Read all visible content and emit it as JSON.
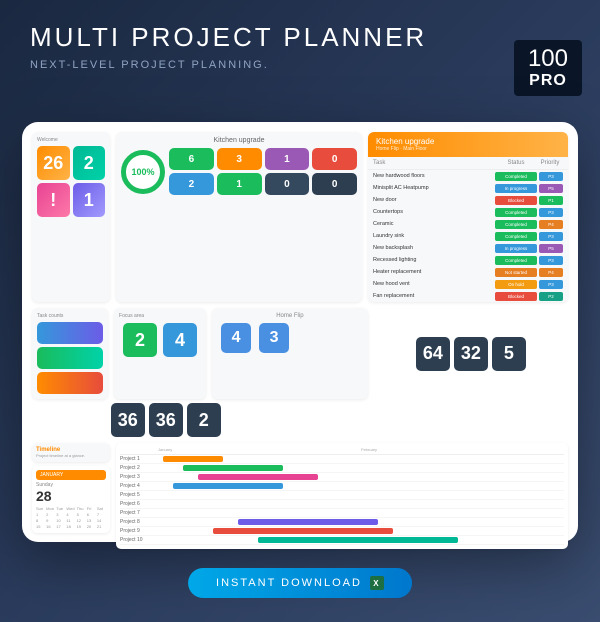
{
  "badge": {
    "num": "100",
    "tag": "PRO"
  },
  "title": "MULTI PROJECT PLANNER",
  "subtitle": "NEXT-LEVEL PROJECT PLANNING.",
  "welcome": {
    "label": "Welcome",
    "tiles": [
      {
        "num": "26",
        "lbl": "",
        "c1": "#ff8c00",
        "c2": "#ffb347"
      },
      {
        "num": "2",
        "lbl": "",
        "c1": "#00b894",
        "c2": "#00d2a8"
      },
      {
        "num": "!",
        "lbl": "",
        "c1": "#e84393",
        "c2": "#fd79a8"
      },
      {
        "num": "1",
        "lbl": "",
        "c1": "#6c5ce7",
        "c2": "#a29bfe"
      }
    ]
  },
  "kitchen": {
    "title": "Kitchen upgrade",
    "pct": "100%",
    "tiles": [
      {
        "num": "6",
        "c": "#1abc5c"
      },
      {
        "num": "3",
        "c": "#ff8c00"
      },
      {
        "num": "1",
        "c": "#9b59b6"
      },
      {
        "num": "0",
        "c": "#e74c3c"
      },
      {
        "num": "2",
        "c": "#3498db"
      },
      {
        "num": "1",
        "c": "#1abc5c"
      },
      {
        "num": "0",
        "c": "#34495e"
      },
      {
        "num": "0",
        "c": "#2c3e50"
      }
    ]
  },
  "taskTable": {
    "header": "Kitchen upgrade",
    "sub": "Home Flip · Main Floor",
    "cols": [
      "Task",
      "Status",
      "Priority"
    ],
    "rows": [
      {
        "task": "New hardwood floors",
        "status": "Completed",
        "sc": "#1abc5c",
        "pri": "P3",
        "pc": "#3498db"
      },
      {
        "task": "Minisplit AC Heatpump",
        "status": "In progress",
        "sc": "#3498db",
        "pri": "P5",
        "pc": "#9b59b6"
      },
      {
        "task": "New door",
        "status": "Blocked",
        "sc": "#e74c3c",
        "pri": "P1",
        "pc": "#1abc5c"
      },
      {
        "task": "Countertops",
        "status": "Completed",
        "sc": "#1abc5c",
        "pri": "P3",
        "pc": "#3498db"
      },
      {
        "task": "Ceramic",
        "status": "Completed",
        "sc": "#1abc5c",
        "pri": "P4",
        "pc": "#e67e22"
      },
      {
        "task": "Laundry sink",
        "status": "Completed",
        "sc": "#1abc5c",
        "pri": "P3",
        "pc": "#3498db"
      },
      {
        "task": "New backsplash",
        "status": "In progress",
        "sc": "#3498db",
        "pri": "P5",
        "pc": "#9b59b6"
      },
      {
        "task": "Recessed lighting",
        "status": "Completed",
        "sc": "#1abc5c",
        "pri": "P3",
        "pc": "#3498db"
      },
      {
        "task": "Heater replacement",
        "status": "Not started",
        "sc": "#e67e22",
        "pri": "P4",
        "pc": "#e67e22"
      },
      {
        "task": "New hood vent",
        "status": "On hold",
        "sc": "#f39c12",
        "pri": "P3",
        "pc": "#3498db"
      },
      {
        "task": "Fan replacement",
        "status": "Blocked",
        "sc": "#e74c3c",
        "pri": "P2",
        "pc": "#16a085"
      }
    ]
  },
  "taskCount": {
    "label": "Task counts",
    "tiles": [
      {
        "num": "",
        "c1": "#3498db",
        "c2": "#6c5ce7"
      },
      {
        "num": "",
        "c1": "#1abc5c",
        "c2": "#00d2a8"
      },
      {
        "num": "",
        "c1": "#ff8c00",
        "c2": "#e74c3c"
      }
    ]
  },
  "focus": {
    "label": "Focus area",
    "tiles": [
      {
        "num": "2",
        "c": "#1abc5c"
      },
      {
        "num": "4",
        "c": "#3498db"
      }
    ]
  },
  "homeflip": {
    "label": "Home Flip",
    "stats": [
      {
        "v": "4"
      },
      {
        "v": "3"
      }
    ]
  },
  "dark1": [
    {
      "n": "36"
    },
    {
      "n": "36"
    },
    {
      "n": "2"
    }
  ],
  "dark2": [
    {
      "n": "64"
    },
    {
      "n": "32"
    },
    {
      "n": "5"
    }
  ],
  "timeline": {
    "label": "Timeline",
    "sub": "Project timeline at a glance."
  },
  "calendar": {
    "month": "JANUARY",
    "day": "Sunday",
    "date": "28",
    "days": [
      "Sun",
      "Mon",
      "Tue",
      "Wed",
      "Thu",
      "Fri",
      "Sat"
    ]
  },
  "gantt": {
    "months": [
      "January",
      "February"
    ],
    "projects": [
      {
        "name": "Project 1",
        "start": 5,
        "len": 60,
        "c": "#ff8c00"
      },
      {
        "name": "Project 2",
        "start": 25,
        "len": 100,
        "c": "#1abc5c"
      },
      {
        "name": "Project 3",
        "start": 40,
        "len": 120,
        "c": "#e84393"
      },
      {
        "name": "Project 4",
        "start": 15,
        "len": 110,
        "c": "#3498db"
      },
      {
        "name": "Project 5",
        "start": 0,
        "len": 0,
        "c": ""
      },
      {
        "name": "Project 6",
        "start": 0,
        "len": 0,
        "c": ""
      },
      {
        "name": "Project 7",
        "start": 0,
        "len": 0,
        "c": ""
      },
      {
        "name": "Project 8",
        "start": 80,
        "len": 140,
        "c": "#6c5ce7"
      },
      {
        "name": "Project 9",
        "start": 55,
        "len": 180,
        "c": "#e74c3c"
      },
      {
        "name": "Project 10",
        "start": 100,
        "len": 200,
        "c": "#00b894"
      }
    ]
  },
  "download": "INSTANT DOWNLOAD"
}
